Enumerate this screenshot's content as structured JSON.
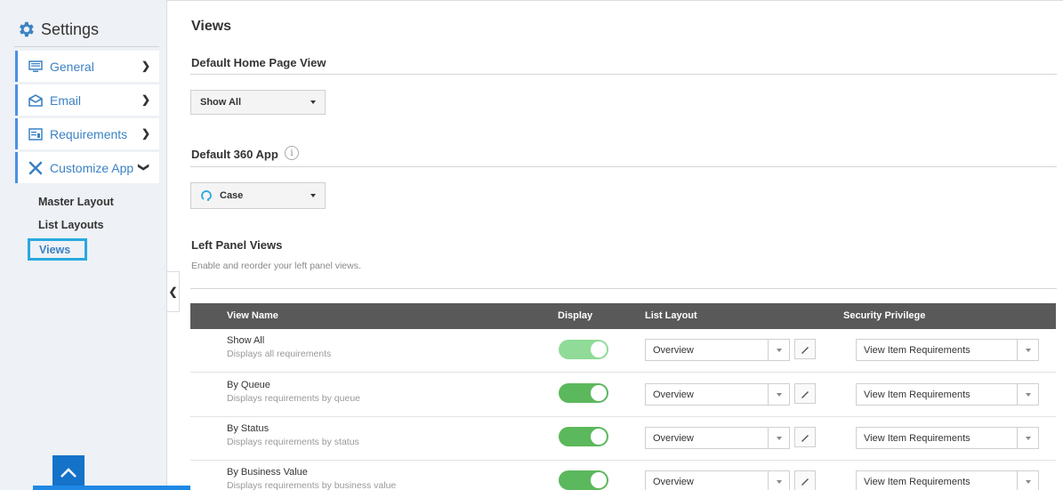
{
  "sidebar": {
    "title": "Settings",
    "items": [
      {
        "label": "General",
        "icon": "monitor-icon"
      },
      {
        "label": "Email",
        "icon": "envelope-icon"
      },
      {
        "label": "Requirements",
        "icon": "list-icon"
      },
      {
        "label": "Customize App",
        "icon": "tools-icon"
      }
    ],
    "sub_items": [
      "Master Layout",
      "List Layouts",
      "Views"
    ],
    "active_sub": "Views"
  },
  "page": {
    "title": "Views",
    "home_view_heading": "Default Home Page View",
    "home_view_value": "Show All",
    "app_heading": "Default 360 App",
    "app_value": "Case",
    "left_panel_heading": "Left Panel Views",
    "left_panel_desc": "Enable and reorder your left panel views."
  },
  "table": {
    "columns": [
      "View Name",
      "Display",
      "List Layout",
      "Security Privilege"
    ],
    "rows": [
      {
        "name": "Show All",
        "desc": "Displays all requirements",
        "display": true,
        "layout": "Overview",
        "privilege": "View Item Requirements"
      },
      {
        "name": "By Queue",
        "desc": "Displays requirements by queue",
        "display": true,
        "layout": "Overview",
        "privilege": "View Item Requirements"
      },
      {
        "name": "By Status",
        "desc": "Displays requirements by status",
        "display": true,
        "layout": "Overview",
        "privilege": "View Item Requirements"
      },
      {
        "name": "By Business Value",
        "desc": "Displays requirements by business value",
        "display": true,
        "layout": "Overview",
        "privilege": "View Item Requirements"
      }
    ]
  },
  "colors": {
    "accent": "#4a90e2",
    "header_bg": "#595959",
    "toggle_on": "#5cb85c",
    "active_border": "#29a8e0"
  }
}
